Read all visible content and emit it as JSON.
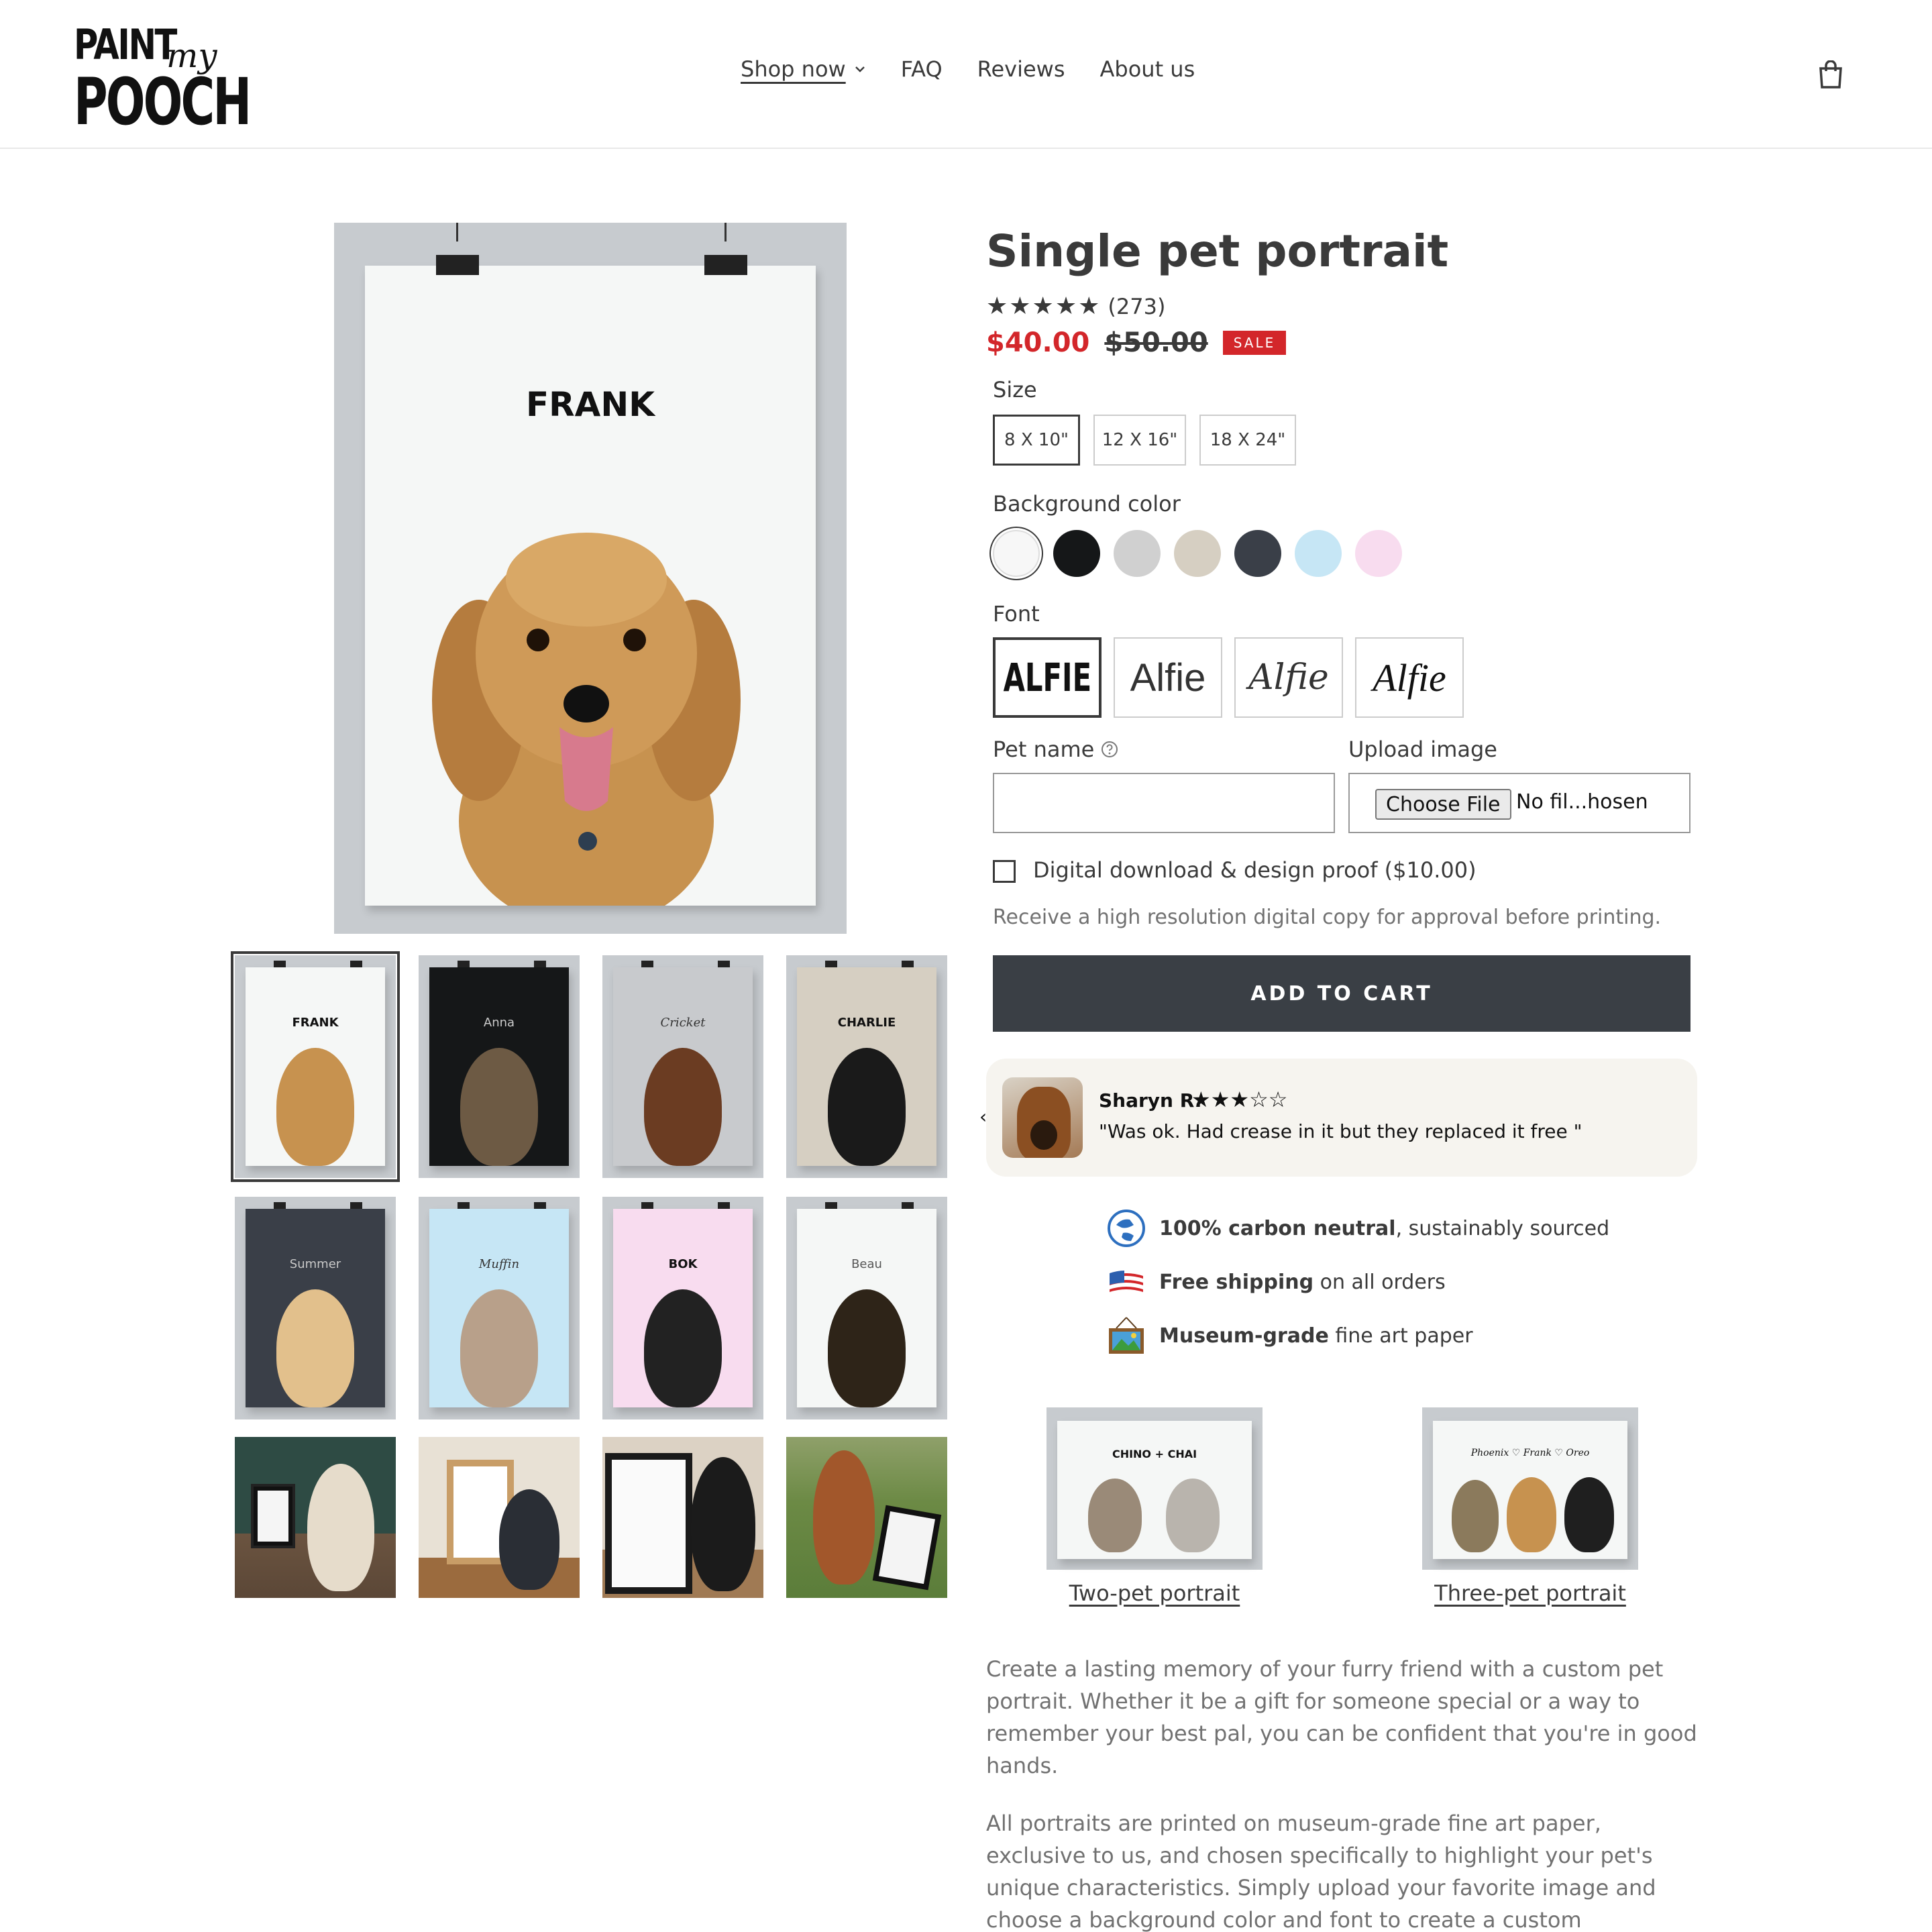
{
  "header": {
    "logo_top": "PAINT",
    "logo_script": "my",
    "logo_bottom": "POOCH",
    "nav": [
      "Shop now",
      "FAQ",
      "Reviews",
      "About us"
    ]
  },
  "gallery": {
    "main_name": "FRANK",
    "thumbs": [
      {
        "name": "FRANK",
        "bg": "#f5f7f6",
        "text": "#111111"
      },
      {
        "name": "Anna",
        "bg": "#151718",
        "text": "#cccccc"
      },
      {
        "name": "Cricket",
        "bg": "#c8cacd",
        "text": "#333333"
      },
      {
        "name": "CHARLIE",
        "bg": "#d6cfc2",
        "text": "#111111"
      },
      {
        "name": "Summer",
        "bg": "#3a3f48",
        "text": "#c9c9c9"
      },
      {
        "name": "Muffin",
        "bg": "#c6e6f5",
        "text": "#333333"
      },
      {
        "name": "BOK",
        "bg": "#f8dcef",
        "text": "#111111"
      },
      {
        "name": "Beau",
        "bg": "#f5f7f6",
        "text": "#555555"
      }
    ]
  },
  "product": {
    "title": "Single pet portrait",
    "rating_count": "(273)",
    "price": "$40.00",
    "compare_price": "$50.00",
    "sale_badge": "SALE",
    "size_label": "Size",
    "sizes": [
      "8 X 10\"",
      "12 X 16\"",
      "18 X 24\""
    ],
    "bg_label": "Background color",
    "bg_colors": [
      "#f7f7f7",
      "#151718",
      "#d0d0d0",
      "#d6cfc2",
      "#3a3f48",
      "#c6e6f5",
      "#f8dcef"
    ],
    "font_label": "Font",
    "fonts": [
      "ALFIE",
      "Alfie",
      "Alfie",
      "Alfie"
    ],
    "pet_name_label": "Pet name",
    "upload_label": "Upload image",
    "choose_file": "Choose File",
    "no_file": "No fil...hosen",
    "digital_label": "Digital download & design proof ($10.00)",
    "digital_help": "Receive a high resolution digital copy for approval before printing.",
    "add_to_cart": "ADD TO CART"
  },
  "review": {
    "name": "Sharyn R.",
    "stars": "★★★☆☆",
    "text": "\"Was ok. Had crease in it but they replaced it free \""
  },
  "features": [
    {
      "bold": "100% carbon neutral",
      "rest": ", sustainably sourced"
    },
    {
      "bold": "Free shipping",
      "rest": " on all orders"
    },
    {
      "bold": "Museum-grade",
      "rest": " fine art paper"
    }
  ],
  "related": [
    {
      "label": "Two-pet portrait",
      "poster": "CHINO + CHAI"
    },
    {
      "label": "Three-pet portrait",
      "poster": "Phoenix ♡ Frank ♡ Oreo"
    }
  ],
  "description": [
    "Create a lasting memory of your furry friend with a custom pet portrait. Whether it be a gift for someone special or a way to remember your best pal, you can be confident that you're in good hands.",
    "All portraits are printed on museum-grade fine art paper, exclusive to us, and chosen specifically to highlight your pet's unique characteristics. Simply upload your favorite image and choose a background color and font to create a custom masterpiece in a"
  ],
  "colors": {
    "accent_sale": "#d3262a",
    "button_dark": "#3a3f45",
    "text": "#3a3a3a",
    "muted": "#717171"
  }
}
